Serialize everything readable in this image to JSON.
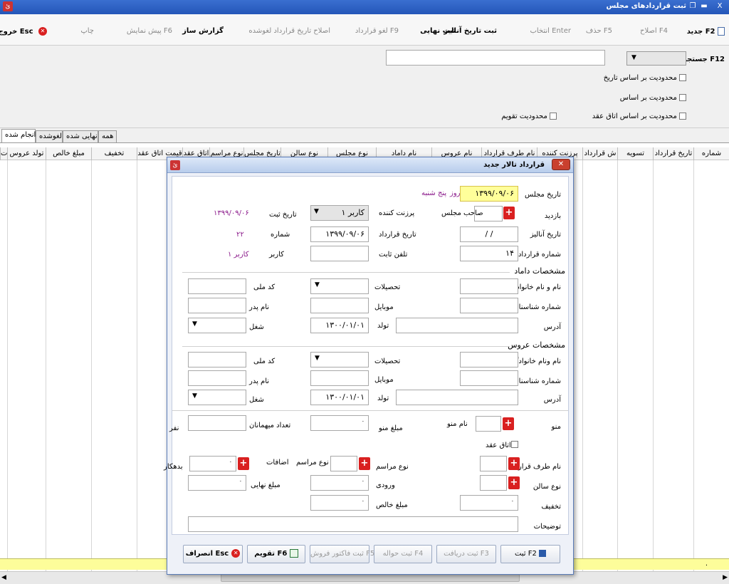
{
  "window": {
    "title": "ثبت قراردادهای مجلس",
    "close": "X"
  },
  "toolbar": {
    "new": "جدید F2",
    "edit": "اصلاح F4",
    "delete": "حذف F5",
    "select": "انتخاب Enter",
    "finalize": "ثبت نهایی",
    "analysis_date": "ثبت تاریخ آنالیز",
    "cancel_contract": "لغو قرارداد F9",
    "fix_cancel_date": "اصلاح تاریخ قرارداد لغوشده",
    "report": "گزارش ساز",
    "preview": "پیش نمایش F6",
    "print": "چاپ",
    "exit": "خروج Esc"
  },
  "search": {
    "label": "جستجو F12",
    "opt_date": "محدودیت بر اساس تاریخ",
    "opt_basis": "محدودیت بر اساس",
    "opt_room": "محدودیت بر اساس    اتاق عقد",
    "opt_calendar": "محدودیت تقویم"
  },
  "tabs": [
    "همه",
    "نهایی شده",
    "لغوشده",
    "انجام شده"
  ],
  "grid": {
    "columns": [
      "شماره",
      "تاریخ قرارداد",
      "تسویه",
      "ش قرارداد",
      "پرزنت کننده",
      "نام طرف قرارداد",
      "نام عروس",
      "نام داماد",
      "نوع مجلس",
      "نوع سالن",
      "تاریخ مجلس",
      "نوع مراسم",
      "اتاق عقد",
      "قیمت اتاق عقد",
      "تخفیف",
      "مبلغ خالص",
      "تولد عروس",
      "ت"
    ],
    "footer_dot": "."
  },
  "dialog": {
    "title": "قرارداد تالار جدید",
    "event_date_label": "تاریخ مجلس",
    "event_date": "۱۳۹۹/۰۹/۰۶",
    "day_label": "روز",
    "day_value": "پنج شنبه",
    "visit_label": "بازدید",
    "host_label": "صاحب مجلس",
    "presenter_label": "پرزنت کننده",
    "presenter_value": "کاربر ۱",
    "reg_date_label": "تاریخ ثبت",
    "reg_date_value": "۱۳۹۹/۰۹/۰۶",
    "analysis_date_label": "تاریخ آنالیز",
    "analysis_date_value": "/ /",
    "contract_date_label": "تاریخ قرارداد",
    "contract_date_value": "۱۳۹۹/۰۹/۰۶",
    "number_label": "شماره",
    "number_value": "۲۲",
    "contract_no_label": "شماره قرارداد",
    "contract_no_value": "۱۴",
    "phone_label": "تلفن ثابت",
    "user_label": "کاربر",
    "user_value": "کاربر ۱",
    "groom_section": "مشخصات داماد",
    "bride_section": "مشخصات عروس",
    "groom": {
      "name_label": "نام و نام خانوادگی",
      "edu_label": "تحصیلات",
      "nid_label": "کد ملی",
      "idno_label": "شماره شناسنامه",
      "mobile_label": "موبایل",
      "father_label": "نام پدر",
      "address_label": "آدرس",
      "birth_label": "تولد",
      "birth_value": "۱۳۰۰/۰۱/۰۱",
      "job_label": "شغل"
    },
    "bride": {
      "name_label": "نام ونام خانوادگی",
      "edu_label": "تحصیلات",
      "nid_label": "کد ملی",
      "idno_label": "شماره شناسنامه",
      "mobile_label": "موبایل",
      "father_label": "نام پدر",
      "address_label": "آدرس",
      "birth_label": "تولد",
      "birth_value": "۱۳۰۰/۰۱/۰۱",
      "job_label": "شغل"
    },
    "menu_label": "منو",
    "menu_name_label": "نام منو",
    "menu_price_label": "مبلغ منو",
    "menu_price_value": "۰",
    "guests_label": "تعداد میهمانان",
    "guests_unit": "نفر",
    "room_label": "اتاق عقد",
    "party_name_label": "نام طرف قرارداد",
    "ceremony_label": "نوع مراسم",
    "ceremony2_label": "نوع مراسم",
    "extras_label": "اضافات",
    "debtor_label": "بدهکار",
    "debtor_value": "۰",
    "hall_label": "نوع سالن",
    "entry_label": "ورودی",
    "entry_value": "۰",
    "final_label": "مبلغ نهایی",
    "final_value": "۰",
    "discount_label": "تخفیف",
    "discount_value": "۰",
    "net_label": "مبلغ خالص",
    "net_value": "۰",
    "notes_label": "توضیحات",
    "buttons": {
      "save": "ثبت F2",
      "receive": "ثبت دریافت F3",
      "transfer": "ثبت حواله F4",
      "invoice": "ثبت فاکتور فروش F5",
      "calendar": "تقویم F6",
      "cancel": "انصراف Esc"
    }
  }
}
